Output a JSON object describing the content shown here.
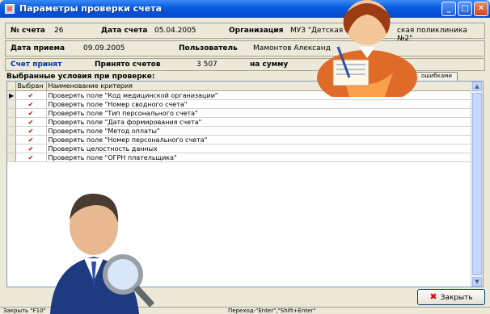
{
  "window": {
    "title": "Параметры проверки счета"
  },
  "header": {
    "account_no_label": "№ счета",
    "account_no": "26",
    "account_date_label": "Дата счета",
    "account_date": "05.04.2005",
    "org_label": "Организация",
    "org_value": "МУЗ \"Детская ст",
    "org_value_tail": "ская поликлиника №2\"",
    "receive_date_label": "Дата приема",
    "receive_date": "09.09.2005",
    "user_label": "Пользователь",
    "user_value": "Мамонтов Александ",
    "status_label": "Счет принят",
    "accepted_label": "Принято счетов",
    "accepted_value": "3 507",
    "sum_label": "на сумму",
    "errors_button": "ошибками"
  },
  "grid": {
    "caption": "Выбранные условия при проверке:",
    "columns": [
      "Выбран",
      "Наименование критерия"
    ],
    "rows": [
      {
        "checked": "✔",
        "name": "Проверять поле \"Код медицинской организации\""
      },
      {
        "checked": "✔",
        "name": "Проверять поле \"Номер сводного счета\""
      },
      {
        "checked": "✔",
        "name": "Проверять поле  \"Тип персонального счета\""
      },
      {
        "checked": "✔",
        "name": "Проверять поле \"Дата формирования счета\""
      },
      {
        "checked": "✔",
        "name": "Проверять поле \"Метод оплаты\""
      },
      {
        "checked": "✔",
        "name": "Проверять поле \"Номер персонального счета\""
      },
      {
        "checked": "✔",
        "name": "Проверять целостность данных"
      },
      {
        "checked": "✔",
        "name": "Проверять поле \"ОГРН плательщика\""
      }
    ]
  },
  "buttons": {
    "close": "Закрыть"
  },
  "status": {
    "left": "Закрыть \"F10\"",
    "center": "Переход-\"Enter\",\"Shift+Enter\""
  },
  "icons": {
    "window": "window-app-icon",
    "minimize": "minimize-icon",
    "maximize": "maximize-icon",
    "close": "close-icon",
    "row_indicator": "row-pointer-icon",
    "check": "checkmark-icon",
    "close_x": "red-x-icon"
  },
  "colors": {
    "title_bar": "#0a5fe0",
    "window_bg": "#ece9d8",
    "checkmark": "#d40000",
    "status_label": "#0033aa"
  }
}
